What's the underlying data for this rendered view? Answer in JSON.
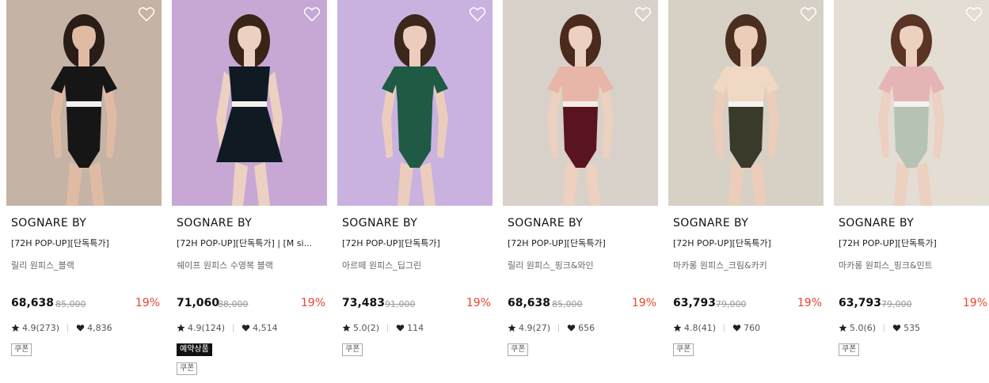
{
  "products": [
    {
      "brand": "SOGNARE BY",
      "title": "[72H POP-UP][단독특가]",
      "subtitle": "릴리 원피스_블랙",
      "price": "68,638",
      "original_price": "85,000",
      "discount": "19%",
      "rating": "4.9(273)",
      "likes": "4,836",
      "coupon": "쿠폰",
      "reserve": null,
      "photo": {
        "bg": "#c5b3a6",
        "skin": "#e0bba4",
        "hair": "#2a1c16",
        "suit": "#161616",
        "trim": "#f1f1ee",
        "swim": "#161616",
        "sleeves": true,
        "skirt": false
      }
    },
    {
      "brand": "SOGNARE BY",
      "title": "[72H POP-UP][단독특가] | [M si...",
      "subtitle": "쉐이프 원피스 수영복 블랙",
      "price": "71,060",
      "original_price": "88,000",
      "discount": "19%",
      "rating": "4.9(124)",
      "likes": "4,514",
      "coupon": "쿠폰",
      "reserve": "예약상품",
      "photo": {
        "bg": "#c7a8d4",
        "skin": "#ecd1c2",
        "hair": "#3a2418",
        "suit": "#0f1a22",
        "trim": "#f3f1ed",
        "swim": "#0f1a22",
        "sleeves": false,
        "skirt": true
      }
    },
    {
      "brand": "SOGNARE BY",
      "title": "[72H POP-UP][단독특가]",
      "subtitle": "아르떼 원피스_딥그린",
      "price": "73,483",
      "original_price": "91,000",
      "discount": "19%",
      "rating": "5.0(2)",
      "likes": "114",
      "coupon": "쿠폰",
      "reserve": null,
      "photo": {
        "bg": "#c9b2e0",
        "skin": "#eccdbd",
        "hair": "#3b271b",
        "suit": "#1f5a45",
        "trim": "#1f5a45",
        "swim": "#1f5a45",
        "sleeves": true,
        "skirt": false
      }
    },
    {
      "brand": "SOGNARE BY",
      "title": "[72H POP-UP][단독특가]",
      "subtitle": "릴리 원피스_핑크&와인",
      "price": "68,638",
      "original_price": "85,000",
      "discount": "19%",
      "rating": "4.9(27)",
      "likes": "656",
      "coupon": "쿠폰",
      "reserve": null,
      "photo": {
        "bg": "#d8d1c9",
        "skin": "#ecd0c0",
        "hair": "#4a2a1c",
        "suit": "#e8b6a8",
        "trim": "#f2eee8",
        "swim": "#5a1420",
        "sleeves": true,
        "skirt": false
      }
    },
    {
      "brand": "SOGNARE BY",
      "title": "[72H POP-UP][단독특가]",
      "subtitle": "마카롱 원피스_크림&카키",
      "price": "63,793",
      "original_price": "79,000",
      "discount": "19%",
      "rating": "4.8(41)",
      "likes": "760",
      "coupon": "쿠폰",
      "reserve": null,
      "photo": {
        "bg": "#d7d0c5",
        "skin": "#ebcdb9",
        "hair": "#4a2e20",
        "suit": "#efd8c4",
        "trim": "#f5f3ee",
        "swim": "#3a3a2a",
        "sleeves": true,
        "skirt": false
      }
    },
    {
      "brand": "SOGNARE BY",
      "title": "[72H POP-UP][단독특가]",
      "subtitle": "마카롱 원피스_핑크&민트",
      "price": "63,793",
      "original_price": "79,000",
      "discount": "19%",
      "rating": "5.0(6)",
      "likes": "535",
      "coupon": "쿠폰",
      "reserve": null,
      "photo": {
        "bg": "#e3ddd4",
        "skin": "#ecd0c0",
        "hair": "#5a3424",
        "suit": "#e5b4b4",
        "trim": "#f5f3ee",
        "swim": "#b5c2b4",
        "sleeves": true,
        "skirt": false
      }
    }
  ],
  "icons": {
    "wishlist": "heart-outline-icon",
    "rating": "star-icon",
    "likes": "heart-filled-icon"
  },
  "colors": {
    "discount": "#e8432e",
    "reserve_badge": "#111111"
  }
}
